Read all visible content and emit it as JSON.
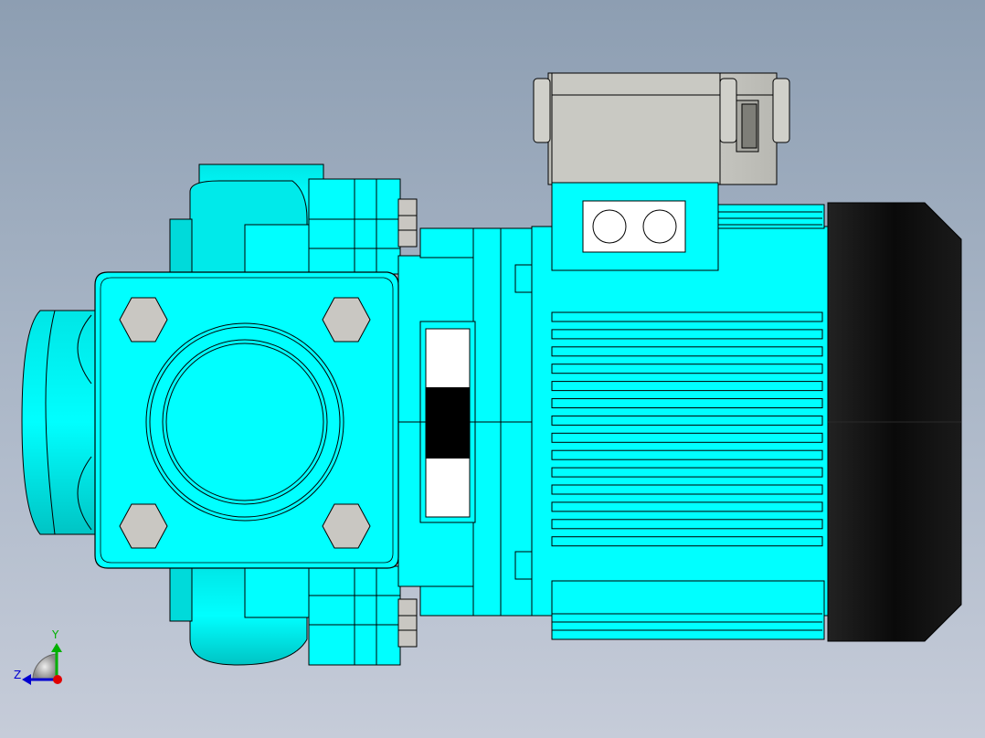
{
  "viewport": {
    "background_top": "#8d9eb2",
    "background_bottom": "#c6ccd9"
  },
  "model": {
    "body_color": "#00ffff",
    "shade_color": "#00d4d4",
    "edge_color": "#000000",
    "fan_cover_color": "#111111",
    "terminal_box_color": "#c8c8c2",
    "bolt_color": "#c9c7c2"
  },
  "triad": {
    "y_label": "Y",
    "z_label": "Z",
    "y_color": "#00b000",
    "z_color": "#0000d0",
    "x_color": "#e00000"
  }
}
